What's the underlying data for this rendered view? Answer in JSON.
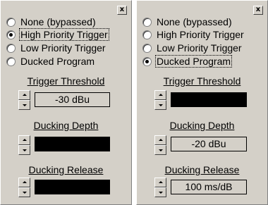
{
  "left_panel": {
    "close_label": "x",
    "options": [
      {
        "label": "None (bypassed)",
        "checked": false
      },
      {
        "label": "High Priority Trigger",
        "checked": true
      },
      {
        "label": "Low Priority Trigger",
        "checked": false
      },
      {
        "label": "Ducked Program",
        "checked": false
      }
    ],
    "trigger_threshold": {
      "title": "Trigger Threshold",
      "value": "-30 dBu"
    },
    "ducking_depth": {
      "title": "Ducking Depth",
      "value": ""
    },
    "ducking_release": {
      "title": "Ducking Release",
      "value": ""
    }
  },
  "right_panel": {
    "close_label": "x",
    "options": [
      {
        "label": "None (bypassed)",
        "checked": false
      },
      {
        "label": "High Priority Trigger",
        "checked": false
      },
      {
        "label": "Low Priority Trigger",
        "checked": false
      },
      {
        "label": "Ducked Program",
        "checked": true
      }
    ],
    "trigger_threshold": {
      "title": "Trigger Threshold",
      "value": ""
    },
    "ducking_depth": {
      "title": "Ducking Depth",
      "value": "-20 dBu"
    },
    "ducking_release": {
      "title": "Ducking Release",
      "value": "100 ms/dB"
    }
  }
}
